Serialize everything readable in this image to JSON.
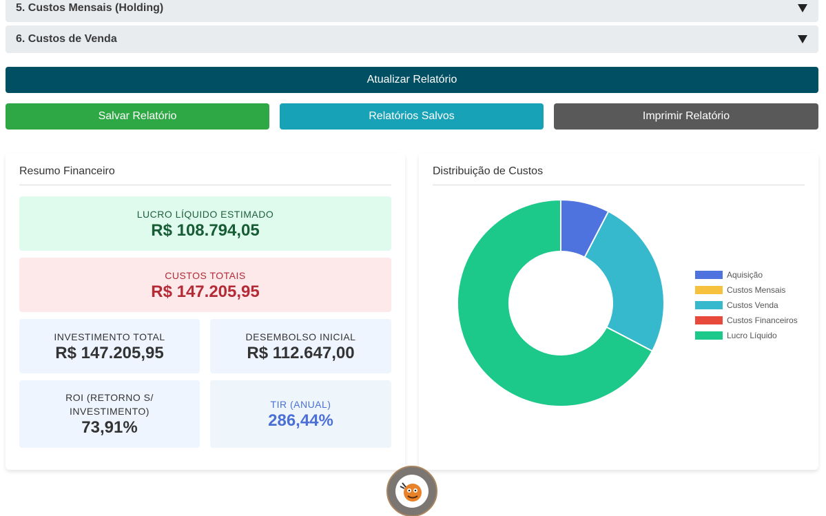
{
  "accordions": [
    {
      "title": "5. Custos Mensais (Holding)"
    },
    {
      "title": "6. Custos de Venda"
    }
  ],
  "buttons": {
    "update": "Atualizar Relatório",
    "save": "Salvar Relatório",
    "saved": "Relatórios Salvos",
    "print": "Imprimir Relatório"
  },
  "summary": {
    "title": "Resumo Financeiro",
    "profit": {
      "label": "LUCRO LÍQUIDO ESTIMADO",
      "value": "R$ 108.794,05"
    },
    "costs": {
      "label": "CUSTOS TOTAIS",
      "value": "R$ 147.205,95"
    },
    "investment": {
      "label": "INVESTIMENTO TOTAL",
      "value": "R$ 147.205,95"
    },
    "outlay": {
      "label": "DESEMBOLSO INICIAL",
      "value": "R$ 112.647,00"
    },
    "roi": {
      "label": "ROI (RETORNO S/ INVESTIMENTO)",
      "value": "73,91%"
    },
    "tir": {
      "label": "TIR (ANUAL)",
      "value": "286,44%"
    }
  },
  "chart_panel": {
    "title": "Distribuição de Custos"
  },
  "chart_data": {
    "type": "pie",
    "variant": "doughnut",
    "legend_position": "right",
    "categories": [
      "Aquisição",
      "Custos Mensais",
      "Custos Venda",
      "Custos Financeiros",
      "Lucro Líquido"
    ],
    "values": [
      19500,
      0,
      64000,
      0,
      172000
    ],
    "colors": [
      "#4e73df",
      "#f6c23e",
      "#36b9cc",
      "#e74a3b",
      "#1cc88a"
    ]
  },
  "colors": {
    "primary": "#014f63",
    "success": "#2ea844",
    "info": "#18a2b8",
    "secondary": "#595959"
  },
  "icons": {
    "accordion_toggle": "caret-down-icon",
    "mascot": "mascot-avatar-icon"
  }
}
